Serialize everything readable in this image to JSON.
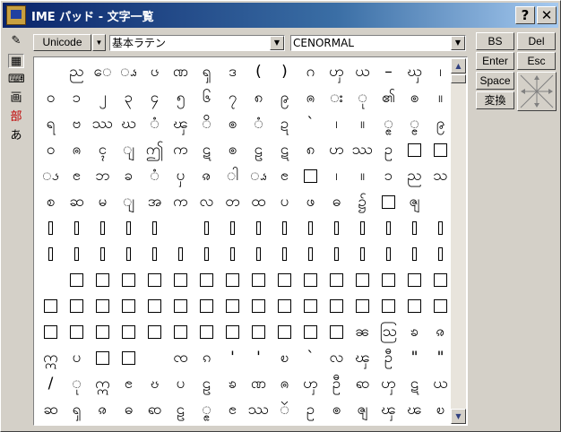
{
  "window": {
    "title": "IME パッド - 文字一覧",
    "help_label": "?",
    "close_label": "✕"
  },
  "toolbar": {
    "encoding": "Unicode",
    "block": "基本ラテン",
    "font": "CENORMAL"
  },
  "side_icons": [
    {
      "name": "handwriting-icon",
      "glyph": "✎"
    },
    {
      "name": "char-list-icon",
      "glyph": "▦"
    },
    {
      "name": "soft-keyboard-icon",
      "glyph": "⌨"
    },
    {
      "name": "stroke-count-icon",
      "glyph": "画"
    },
    {
      "name": "radical-icon",
      "glyph": "部"
    },
    {
      "name": "hiragana-icon",
      "glyph": "あ"
    }
  ],
  "keys": {
    "bs": "BS",
    "del": "Del",
    "enter": "Enter",
    "esc": "Esc",
    "space": "Space",
    "convert": "変換"
  },
  "grid_rows": [
    [
      "",
      "ည",
      "ေ",
      "ၗ",
      "ၒ",
      "ဏ",
      "ၡ",
      "ဒ",
      "(",
      ")",
      "ဂ",
      "ၯ",
      "ယ",
      "–",
      "ၰ",
      "၊"
    ],
    [
      "ဝ",
      "၁",
      "၂",
      "၃",
      "၄",
      "၅",
      "၆",
      "၇",
      "၈",
      "၉",
      "ၐ",
      "း",
      "ု",
      "၏",
      "ၜ",
      "။"
    ],
    [
      "ရ",
      "ဗ",
      "ဿ",
      "ဃ",
      "ံ",
      "ၾ",
      "ိ",
      "ၜ",
      "ံ",
      "ဍ",
      "`",
      "၊",
      "။",
      "ၙ",
      "ၘ",
      "၉"
    ],
    [
      "ဝ",
      "ၐ",
      "ၚ",
      "ျ",
      "ဤ",
      "က",
      "ဋ",
      "ၜ",
      "ဠ",
      "ဋ",
      "၈",
      "ဟ",
      "ဿ",
      "ဥ",
      "□",
      "□"
    ],
    [
      "ၖ",
      "ၔ",
      "ဘ",
      "ခ",
      "ံ",
      "ၦ",
      "ၷ",
      "ါ",
      "ၗ",
      "ၔ",
      "□",
      "၊",
      "။",
      "၁",
      "ည",
      "သ"
    ],
    [
      "စ",
      "ဆ",
      "မ",
      "ျ",
      "အ",
      "က",
      "လ",
      "တ",
      "ထ",
      "ပ",
      "ဖ",
      "ဓ",
      "၌",
      "□",
      "ၛ",
      ""
    ],
    [
      "▯",
      "▯",
      "▯",
      "▯",
      "▯",
      "",
      "▯",
      "▯",
      "▯",
      "▯",
      "▯",
      "▯",
      "▯",
      "▯",
      "▯",
      "▯"
    ],
    [
      "▯",
      "▯",
      "▯",
      "▯",
      "▯",
      "▯",
      "▯",
      "▯",
      "▯",
      "▯",
      "▯",
      "▯",
      "▯",
      "▯",
      "▯",
      "▯"
    ],
    [
      "",
      "□",
      "□",
      "□",
      "□",
      "□",
      "□",
      "□",
      "□",
      "□",
      "□",
      "□",
      "□",
      "□",
      "□",
      "□"
    ],
    [
      "□",
      "□",
      "□",
      "□",
      "□",
      "□",
      "□",
      "□",
      "□",
      "□",
      "□",
      "□",
      "□",
      "□",
      "□",
      "□"
    ],
    [
      "□",
      "□",
      "□",
      "□",
      "□",
      "□",
      "□",
      "□",
      "□",
      "□",
      "□",
      "□",
      "ၼ",
      "ဩ",
      "ၶ",
      "ၷ"
    ],
    [
      "ဣ",
      "ပ",
      "□",
      "□",
      "",
      "ၸ",
      "ၵ",
      "'",
      "'",
      "ၿ",
      "`",
      "လ",
      "ၾ",
      "ဦ",
      "\"",
      "\""
    ],
    [
      "/",
      "ု",
      "ဣ",
      "ၔ",
      "ၓ",
      "ပ",
      "ဠ",
      "ၶ",
      "ဏ",
      "ၐ",
      "ၯ",
      "ဦ",
      "ၹ",
      "ၯ",
      "ဋ",
      "ယ"
    ],
    [
      "ဆ",
      "ၡ",
      "ၷ",
      "ဓ",
      "ၹ",
      "ဠ",
      "ၙ",
      "ၔ",
      "ဿ",
      "ၴ",
      "ဥ",
      "ၜ",
      "ၛ",
      "ၾ",
      "ၽ",
      "ၿ"
    ]
  ],
  "scrollbar": {
    "up": "▲",
    "down": "▼"
  }
}
